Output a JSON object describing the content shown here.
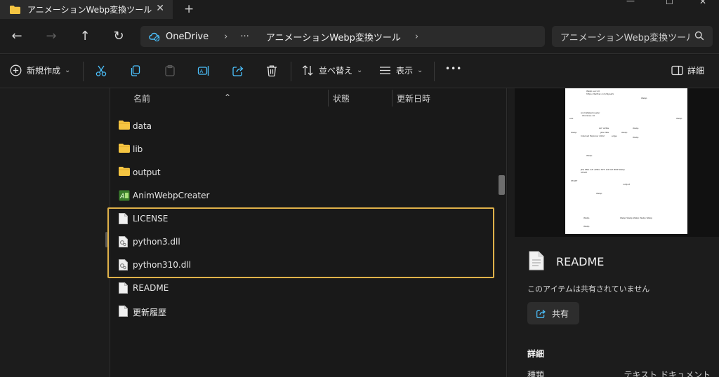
{
  "window": {
    "tab_title": "アニメーションWebp変換ツール",
    "tab_close": "✕",
    "new_tab": "+",
    "min": "—",
    "max": "☐",
    "close": "✕"
  },
  "nav": {
    "back": "←",
    "forward": "→",
    "up": "↑",
    "refresh": "↻"
  },
  "address": {
    "root": "OneDrive",
    "sep1": "›",
    "ellipsis": "···",
    "folder": "アニメーションWebp変換ツール",
    "sep2": "›"
  },
  "search": {
    "placeholder": "アニメーションWebp変換ツールの検索"
  },
  "commands": {
    "new_label": "新規作成",
    "sort_label": "並べ替え",
    "view_label": "表示",
    "more": "•••",
    "details_label": "詳細"
  },
  "columns": {
    "name": "名前",
    "status": "状態",
    "modified": "更新日時"
  },
  "files": [
    {
      "name": "data",
      "type": "folder"
    },
    {
      "name": "lib",
      "type": "folder"
    },
    {
      "name": "output",
      "type": "folder"
    },
    {
      "name": "AnimWebpCreater",
      "type": "app"
    },
    {
      "name": "LICENSE",
      "type": "doc"
    },
    {
      "name": "python3.dll",
      "type": "dll"
    },
    {
      "name": "python310.dll",
      "type": "dll"
    },
    {
      "name": "README",
      "type": "doc"
    },
    {
      "name": "更新履歴",
      "type": "doc"
    }
  ],
  "details_pane": {
    "title": "README",
    "share_status": "このアイテムは共有されていません",
    "share_button": "共有",
    "section_title": "詳細",
    "kind_label": "種類",
    "kind_value": "テキスト ドキュメント"
  },
  "colors": {
    "highlight_border": "#e0b24a",
    "folder": "#f5c542",
    "accent": "#4cc2ff"
  }
}
